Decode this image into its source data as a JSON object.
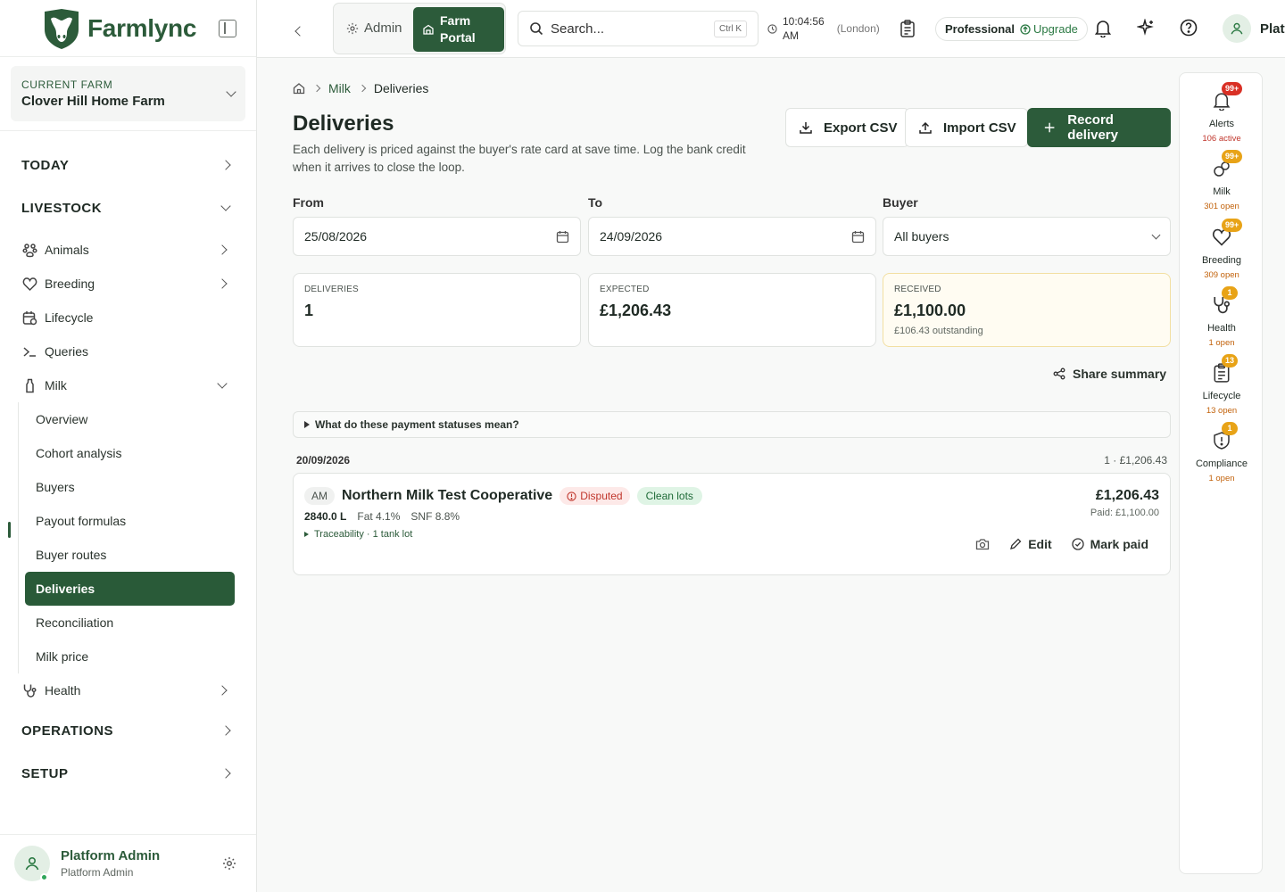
{
  "brand": {
    "name": "Farmlync"
  },
  "farm": {
    "label": "CURRENT FARM",
    "name": "Clover Hill Home Farm"
  },
  "nav": {
    "today": "TODAY",
    "livestock": "LIVESTOCK",
    "items": {
      "animals": "Animals",
      "breeding": "Breeding",
      "lifecycle": "Lifecycle",
      "queries": "Queries",
      "milk": "Milk",
      "health": "Health"
    },
    "milk_sub": [
      "Overview",
      "Cohort analysis",
      "Buyers",
      "Payout formulas",
      "Buyer routes",
      "Deliveries",
      "Reconciliation",
      "Milk price"
    ],
    "operations": "OPERATIONS",
    "setup": "SETUP"
  },
  "user": {
    "name": "Platform Admin",
    "role": "Platform Admin"
  },
  "topbar": {
    "admin": "Admin",
    "farm_portal": "Farm Portal",
    "search_placeholder": "Search...",
    "search_kbd": "Ctrl K",
    "time": "10:04:56",
    "ampm": "AM",
    "tz": "(London)",
    "plan": "Professional",
    "upgrade": "Upgrade",
    "user_short": "Platf"
  },
  "breadcrumb": {
    "parent": "Milk",
    "current": "Deliveries"
  },
  "page": {
    "title": "Deliveries",
    "description": "Each delivery is priced against the buyer's rate card at save time. Log the bank credit when it arrives to close the loop."
  },
  "buttons": {
    "export": "Export CSV",
    "import": "Import CSV",
    "record": "Record delivery"
  },
  "filters": {
    "from_label": "From",
    "from_value": "25/08/2026",
    "to_label": "To",
    "to_value": "24/09/2026",
    "buyer_label": "Buyer",
    "buyer_value": "All buyers"
  },
  "stats": {
    "deliveries_label": "DELIVERIES",
    "deliveries_value": "1",
    "expected_label": "EXPECTED",
    "expected_value": "£1,206.43",
    "received_label": "RECEIVED",
    "received_value": "£1,100.00",
    "received_sub": "£106.43 outstanding"
  },
  "share": "Share summary",
  "faq": "What do these payment statuses mean?",
  "day": {
    "date": "20/09/2026",
    "summary": "1 · £1,206.43"
  },
  "delivery": {
    "session": "AM",
    "buyer": "Northern Milk Test Cooperative",
    "status": "Disputed",
    "lots": "Clean lots",
    "litres": "2840.0 L",
    "fat": "Fat 4.1%",
    "snf": "SNF 8.8%",
    "traceability": "Traceability · 1 tank lot",
    "amount": "£1,206.43",
    "paid": "Paid: £1,100.00",
    "edit": "Edit",
    "mark_paid": "Mark paid"
  },
  "rail": [
    {
      "name": "Alerts",
      "count": "99+",
      "status": "106 active"
    },
    {
      "name": "Milk",
      "count": "99+",
      "status": "301 open"
    },
    {
      "name": "Breeding",
      "count": "99+",
      "status": "309 open"
    },
    {
      "name": "Health",
      "count": "1",
      "status": "1 open"
    },
    {
      "name": "Lifecycle",
      "count": "13",
      "status": "13 open"
    },
    {
      "name": "Compliance",
      "count": "1",
      "status": "1 open"
    }
  ]
}
